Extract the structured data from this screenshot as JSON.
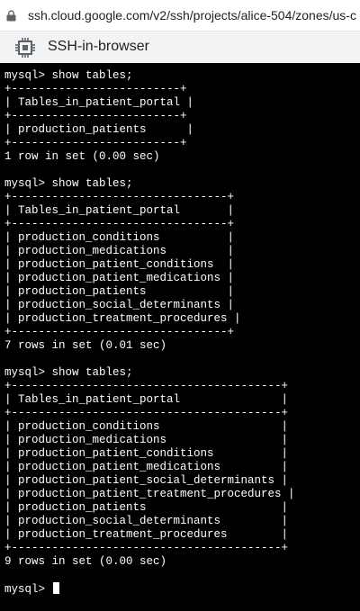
{
  "browser": {
    "url": "ssh.cloud.google.com/v2/ssh/projects/alice-504/zones/us-c",
    "window_title": "SSH-in-browser",
    "icons": {
      "url": "lock-icon",
      "app": "chip-icon"
    }
  },
  "terminal": {
    "lines": [
      "mysql> show tables;",
      "+-------------------------+",
      "| Tables_in_patient_portal |",
      "+-------------------------+",
      "| production_patients      |",
      "+-------------------------+",
      "1 row in set (0.00 sec)",
      "",
      "mysql> show tables;",
      "+--------------------------------+",
      "| Tables_in_patient_portal       |",
      "+--------------------------------+",
      "| production_conditions          |",
      "| production_medications         |",
      "| production_patient_conditions  |",
      "| production_patient_medications |",
      "| production_patients            |",
      "| production_social_determinants |",
      "| production_treatment_procedures |",
      "+--------------------------------+",
      "7 rows in set (0.01 sec)",
      "",
      "mysql> show tables;",
      "+----------------------------------------+",
      "| Tables_in_patient_portal               |",
      "+----------------------------------------+",
      "| production_conditions                  |",
      "| production_medications                 |",
      "| production_patient_conditions          |",
      "| production_patient_medications         |",
      "| production_patient_social_determinants |",
      "| production_patient_treatment_procedures |",
      "| production_patients                    |",
      "| production_social_determinants         |",
      "| production_treatment_procedures        |",
      "+----------------------------------------+",
      "9 rows in set (0.00 sec)",
      "",
      "mysql> "
    ]
  }
}
